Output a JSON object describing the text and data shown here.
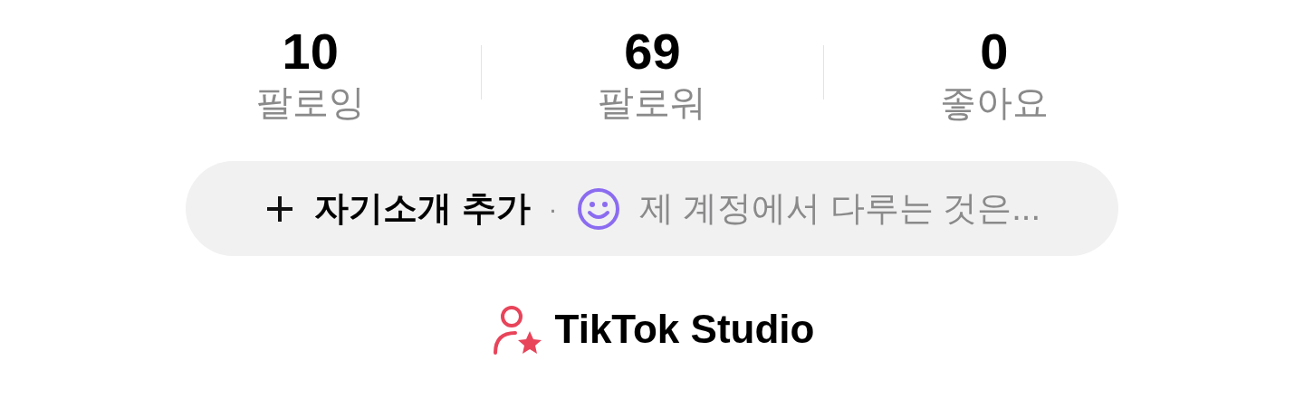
{
  "stats": [
    {
      "value": "10",
      "label": "팔로잉"
    },
    {
      "value": "69",
      "label": "팔로워"
    },
    {
      "value": "0",
      "label": "좋아요"
    }
  ],
  "bio_bar": {
    "add_label": "자기소개 추가",
    "separator": "·",
    "prompt": "제 계정에서 다루는 것은..."
  },
  "studio_link": {
    "label": "TikTok Studio"
  }
}
